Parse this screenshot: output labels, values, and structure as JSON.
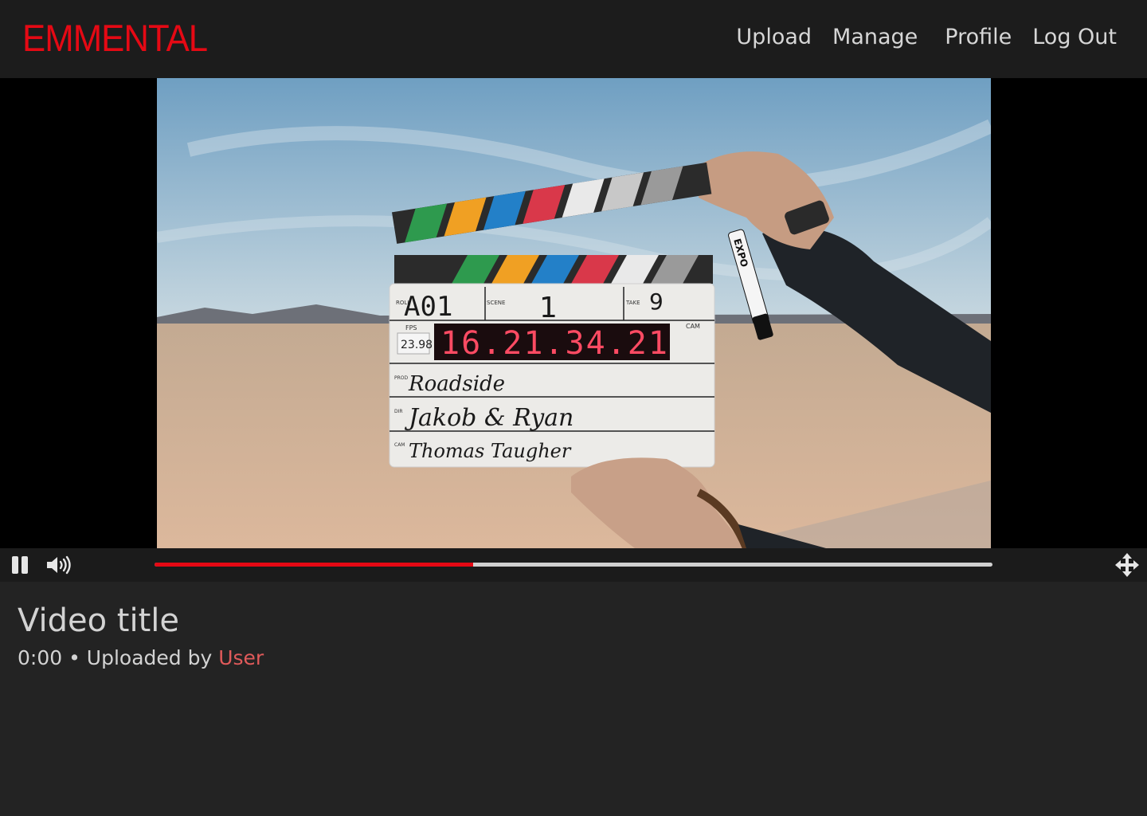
{
  "header": {
    "logo": "EMMENTAL",
    "nav": {
      "upload": "Upload",
      "manage": "Manage",
      "profile": "Profile",
      "logout": "Log Out"
    }
  },
  "player": {
    "icons": {
      "pause": "pause-icon",
      "volume": "volume-icon",
      "fullscreen": "move-arrows-icon"
    },
    "progress": 0.38,
    "colors": {
      "progress": "#e50914",
      "track": "#d0d0d0"
    },
    "slate": {
      "roll_label": "ROLL",
      "roll": "A01",
      "scene_label": "SCENE",
      "scene": "1",
      "take_label": "TAKE",
      "take": "9",
      "fps_label": "FPS",
      "fps": "23.98",
      "timecode": "16.21.34.21",
      "cam_label": "CAM",
      "prod_label": "PROD",
      "production": "Roadside",
      "dir_label": "DIR",
      "director": "Jakob & Ryan",
      "cam_op_label": "CAM",
      "camera": "Thomas Taugher",
      "marker": "EXPO"
    }
  },
  "video": {
    "title": "Video title",
    "time": "0:00",
    "separator": " • ",
    "uploaded_by": "Uploaded by ",
    "user": "User"
  },
  "colors": {
    "brand": "#e50914",
    "user_link": "#e05a5a"
  }
}
